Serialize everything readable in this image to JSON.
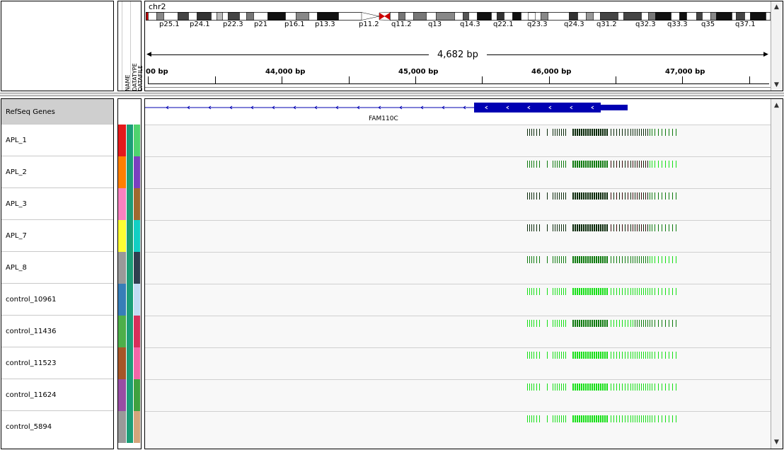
{
  "chromosome": "chr2",
  "ideogram_bands": [
    {
      "label": "p25.1"
    },
    {
      "label": "p24.1"
    },
    {
      "label": "p22.3"
    },
    {
      "label": "p21"
    },
    {
      "label": "p16.1"
    },
    {
      "label": "p13.3"
    },
    {
      "label": "p11.2"
    },
    {
      "label": "q11.2"
    },
    {
      "label": "q13"
    },
    {
      "label": "q14.3"
    },
    {
      "label": "q22.1"
    },
    {
      "label": "q23.3"
    },
    {
      "label": "q24.3"
    },
    {
      "label": "q31.2"
    },
    {
      "label": "q32.3"
    },
    {
      "label": "q33.3"
    },
    {
      "label": "q35"
    },
    {
      "label": "q37.1"
    }
  ],
  "span_label": "4,682 bp",
  "ruler_ticks": [
    "00 bp",
    "44,000 bp",
    "45,000 bp",
    "46,000 bp",
    "47,000 bp"
  ],
  "attribute_headers": [
    "NAME",
    "DATATYPE",
    "DATAFILE"
  ],
  "gene_track": {
    "name": "RefSeq Genes",
    "gene_name": "FAM110C"
  },
  "tracks": [
    {
      "name": "APL_1"
    },
    {
      "name": "APL_2"
    },
    {
      "name": "APL_3"
    },
    {
      "name": "APL_7"
    },
    {
      "name": "APL_8"
    },
    {
      "name": "control_10961"
    },
    {
      "name": "control_11436"
    },
    {
      "name": "control_11523"
    },
    {
      "name": "control_11624"
    },
    {
      "name": "control_5894"
    }
  ],
  "colors": {
    "gene": "#0000b2",
    "methyl_low": "#16e016",
    "methyl_mid": "#0e7a0e",
    "methyl_high": "#0a2a0a",
    "methyl_red": "#3a0a0a",
    "centromere": "#cc0000",
    "attr_name": [
      "#e31a1c",
      "#ff7f00",
      "#f781bf",
      "#ffff33",
      "#999999",
      "#377eb8",
      "#4daf4a",
      "#a65628",
      "#984ea3",
      "#999999"
    ],
    "attr_type": "#1b9e77",
    "attr_file": [
      "#4fd36e",
      "#7b3fbf",
      "#a0692f",
      "#12cfc4",
      "#2f3f4f",
      "#c2dbf2",
      "#d62f5b",
      "#f266a8",
      "#3fa13f",
      "#d3a57b"
    ]
  }
}
